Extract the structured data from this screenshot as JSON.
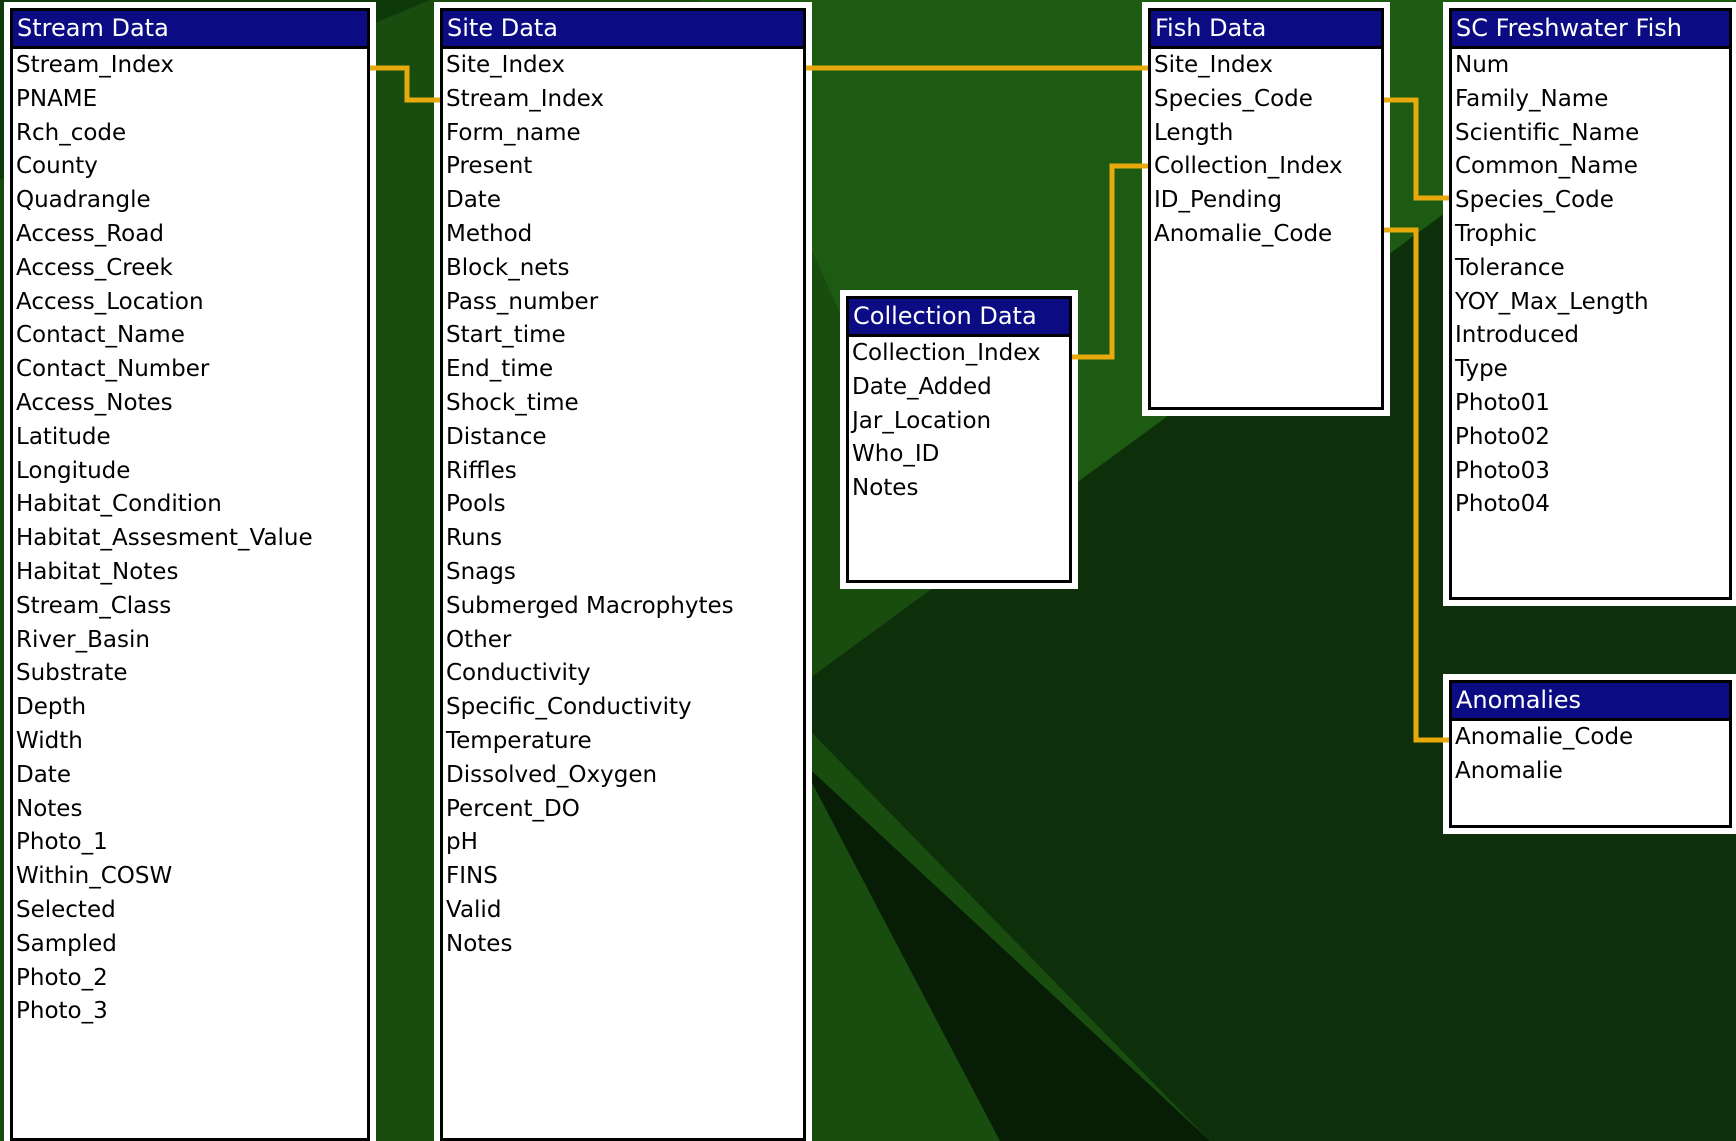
{
  "colors": {
    "background": "#1d5a12",
    "title_bar": "#0b0b84",
    "link_line": "#e8a90c"
  },
  "tables": {
    "stream": {
      "title": "Stream Data",
      "fields": [
        "Stream_Index",
        "PNAME",
        "Rch_code",
        "County",
        "Quadrangle",
        "Access_Road",
        "Access_Creek",
        "Access_Location",
        "Contact_Name",
        "Contact_Number",
        "Access_Notes",
        "Latitude",
        "Longitude",
        "Habitat_Condition",
        "Habitat_Assesment_Value",
        "Habitat_Notes",
        "Stream_Class",
        "River_Basin",
        "Substrate",
        "Depth",
        "Width",
        "Date",
        "Notes",
        "Photo_1",
        "Within_COSW",
        "Selected",
        "Sampled",
        "Photo_2",
        "Photo_3"
      ]
    },
    "site": {
      "title": "Site Data",
      "fields": [
        "Site_Index",
        "Stream_Index",
        "Form_name",
        "Present",
        "Date",
        "Method",
        "Block_nets",
        "Pass_number",
        "Start_time",
        "End_time",
        "Shock_time",
        "Distance",
        "Riffles",
        "Pools",
        "Runs",
        "Snags",
        "Submerged Macrophytes",
        "Other",
        "Conductivity",
        "Specific_Conductivity",
        "Temperature",
        "Dissolved_Oxygen",
        "Percent_DO",
        "pH",
        "FINS",
        "Valid",
        "Notes"
      ]
    },
    "collection": {
      "title": "Collection Data",
      "fields": [
        "Collection_Index",
        "Date_Added",
        "Jar_Location",
        "Who_ID",
        "Notes"
      ]
    },
    "fish": {
      "title": "Fish Data",
      "fields": [
        "Site_Index",
        "Species_Code",
        "Length",
        "Collection_Index",
        "ID_Pending",
        "Anomalie_Code"
      ]
    },
    "sc_fish": {
      "title": "SC Freshwater Fish",
      "fields": [
        "Num",
        "Family_Name",
        "Scientific_Name",
        "Common_Name",
        "Species_Code",
        "Trophic",
        "Tolerance",
        "YOY_Max_Length",
        "Introduced",
        "Type",
        "Photo01",
        "Photo02",
        "Photo03",
        "Photo04"
      ]
    },
    "anomalies": {
      "title": "Anomalies",
      "fields": [
        "Anomalie_Code",
        "Anomalie"
      ]
    }
  }
}
